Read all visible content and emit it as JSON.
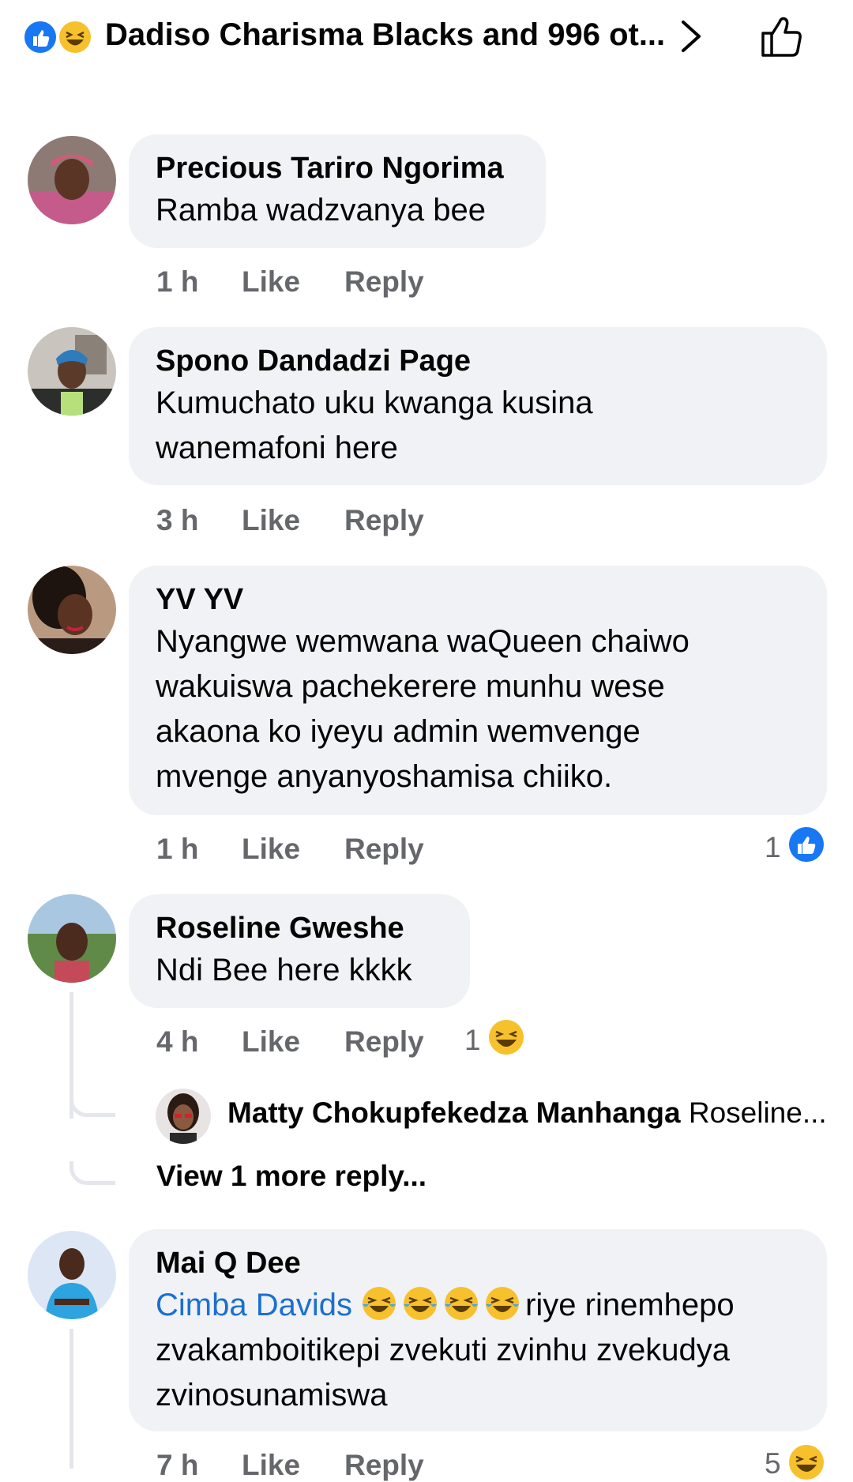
{
  "header": {
    "reactions_summary": "Dadiso Charisma Blacks and 996 ot..."
  },
  "comments": [
    {
      "author": "Precious Tariro Ngorima",
      "text": "Ramba wadzvanya bee",
      "time": "1 h",
      "like": "Like",
      "reply": "Reply"
    },
    {
      "author": "Spono Dandadzi Page",
      "text_lines": [
        "Kumuchato uku kwanga kusina",
        "wanemafoni here"
      ],
      "time": "3 h",
      "like": "Like",
      "reply": "Reply"
    },
    {
      "author": "YV YV",
      "text_lines": [
        "Nyangwe wemwana waQueen chaiwo",
        "wakuiswa pachekerere munhu wese",
        "akaona ko iyeyu admin wemvenge",
        "mvenge anyanyoshamisa chiiko."
      ],
      "time": "1 h",
      "like": "Like",
      "reply": "Reply",
      "reaction_count": "1"
    },
    {
      "author": "Roseline Gweshe",
      "text": "Ndi Bee here kkkk",
      "time": "4 h",
      "like": "Like",
      "reply": "Reply",
      "reaction_count": "1",
      "reply_preview": {
        "author": "Matty Chokupfekedza Manhanga",
        "snippet": "Roseline..."
      },
      "view_more": "View 1 more reply..."
    },
    {
      "author": "Mai Q Dee",
      "mention": "Cimba Davids",
      "text_after_emoji": "riye rinemhepo",
      "text_lines": [
        "zvakamboitikepi zvekuti zvinhu zvekudya",
        "zvinosunamiswa"
      ],
      "time": "7 h",
      "like": "Like",
      "reply": "Reply",
      "reaction_count": "5"
    }
  ],
  "colors": {
    "bubble": "#f0f2f5",
    "meta": "#65676b",
    "like_blue": "#1877f2",
    "mention": "#1b6fd1",
    "haha_yellow": "#f7c12d"
  },
  "icons": [
    "like-reaction-icon",
    "haha-reaction-icon",
    "chevron-right-icon",
    "thumbs-up-outline-icon",
    "laughing-tears-emoji"
  ]
}
